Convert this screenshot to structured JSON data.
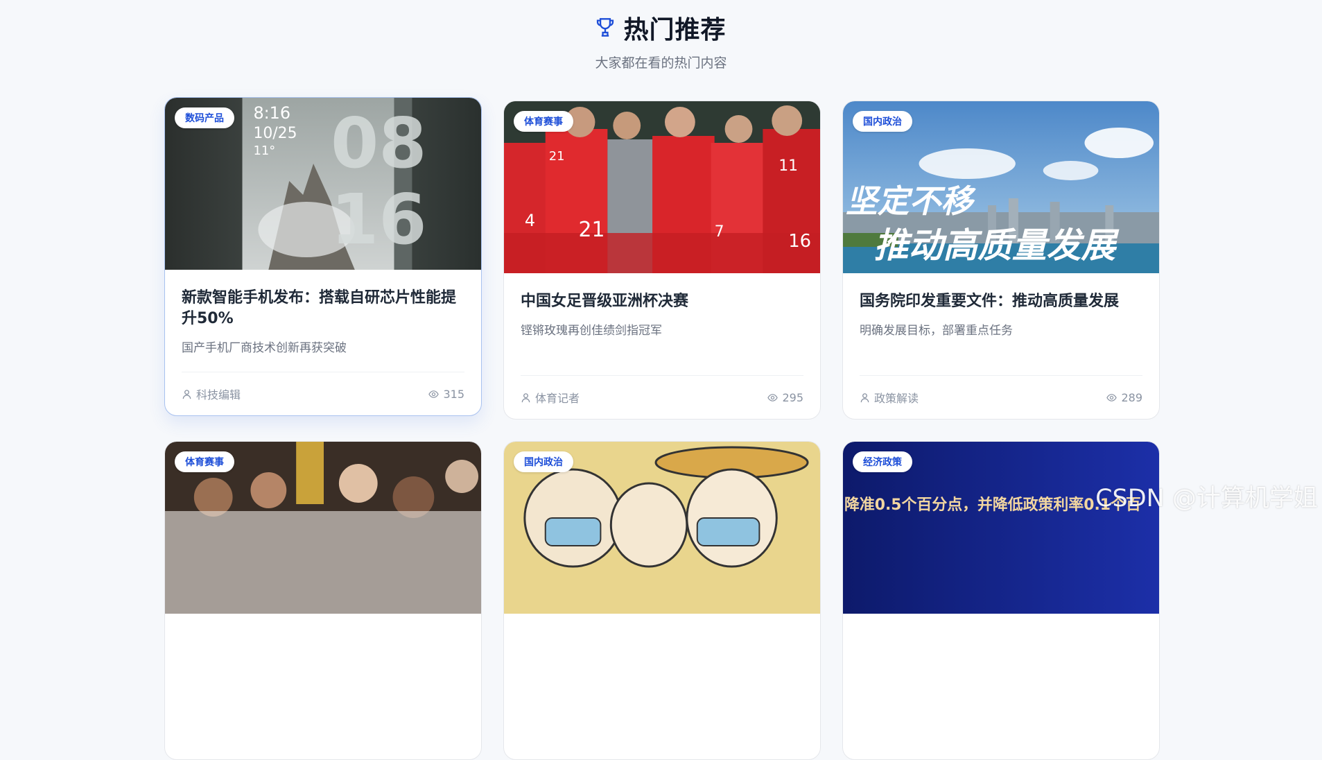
{
  "section": {
    "icon": "trophy-icon",
    "title": "热门推荐",
    "subtitle": "大家都在看的热门内容"
  },
  "cards": [
    {
      "category": "数码产品",
      "title": "新款智能手机发布：搭载自研芯片性能提升50%",
      "desc": "国产手机厂商技术创新再获突破",
      "author": "科技编辑",
      "views": "315",
      "image_text": [
        "8:16",
        "10/25",
        "11°",
        "08",
        "16"
      ]
    },
    {
      "category": "体育赛事",
      "title": "中国女足晋级亚洲杯决赛",
      "desc": "铿锵玫瑰再创佳绩剑指冠军",
      "author": "体育记者",
      "views": "295",
      "image_text": [
        "4",
        "21",
        "21",
        "7",
        "11",
        "16"
      ]
    },
    {
      "category": "国内政治",
      "title": "国务院印发重要文件：推动高质量发展",
      "desc": "明确发展目标，部署重点任务",
      "author": "政策解读",
      "views": "289",
      "image_text": [
        "坚定不移",
        "推动高质量发展"
      ]
    },
    {
      "category": "体育赛事"
    },
    {
      "category": "国内政治"
    },
    {
      "category": "经济政策",
      "image_text": [
        "降准0.5个百分点，并降低政策利率0.1个百"
      ]
    }
  ],
  "watermark": "CSDN @计算机学姐",
  "colors": {
    "accent": "#1d4ed8",
    "background": "#f6f8fb",
    "hover_border": "#a8c1ef"
  }
}
